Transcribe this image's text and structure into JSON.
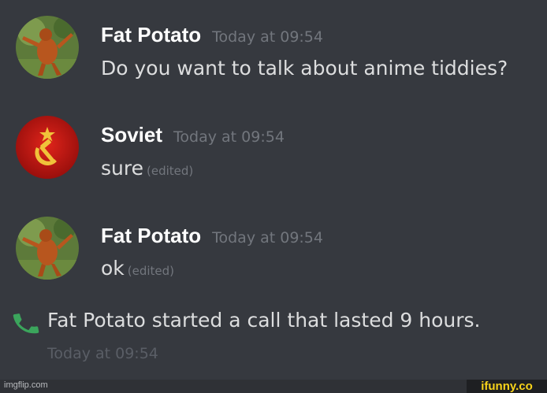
{
  "messages": [
    {
      "author": "Fat Potato",
      "timestamp": "Today at 09:54",
      "text": "Do you want to talk about anime tiddies?",
      "edited": "",
      "avatar": "orangutan-avatar"
    },
    {
      "author": "Soviet",
      "timestamp": "Today at 09:54",
      "text": "sure",
      "edited": "(edited)",
      "avatar": "soviet-emblem-avatar"
    },
    {
      "author": "Fat Potato",
      "timestamp": "Today at 09:54",
      "text": "ok",
      "edited": "(edited)",
      "avatar": "orangutan-avatar"
    }
  ],
  "call": {
    "icon": "phone-icon",
    "text": "Fat Potato started a call that lasted 9 hours.",
    "timestamp": "Today at 09:54"
  },
  "watermarks": {
    "left": "imgflip.com",
    "right": "ifunny.co"
  },
  "colors": {
    "background": "#36393f",
    "author": "#ffffff",
    "text": "#dcddde",
    "muted": "#72767d",
    "call_icon": "#3ba55c",
    "ifunny": "#f8d31a"
  }
}
